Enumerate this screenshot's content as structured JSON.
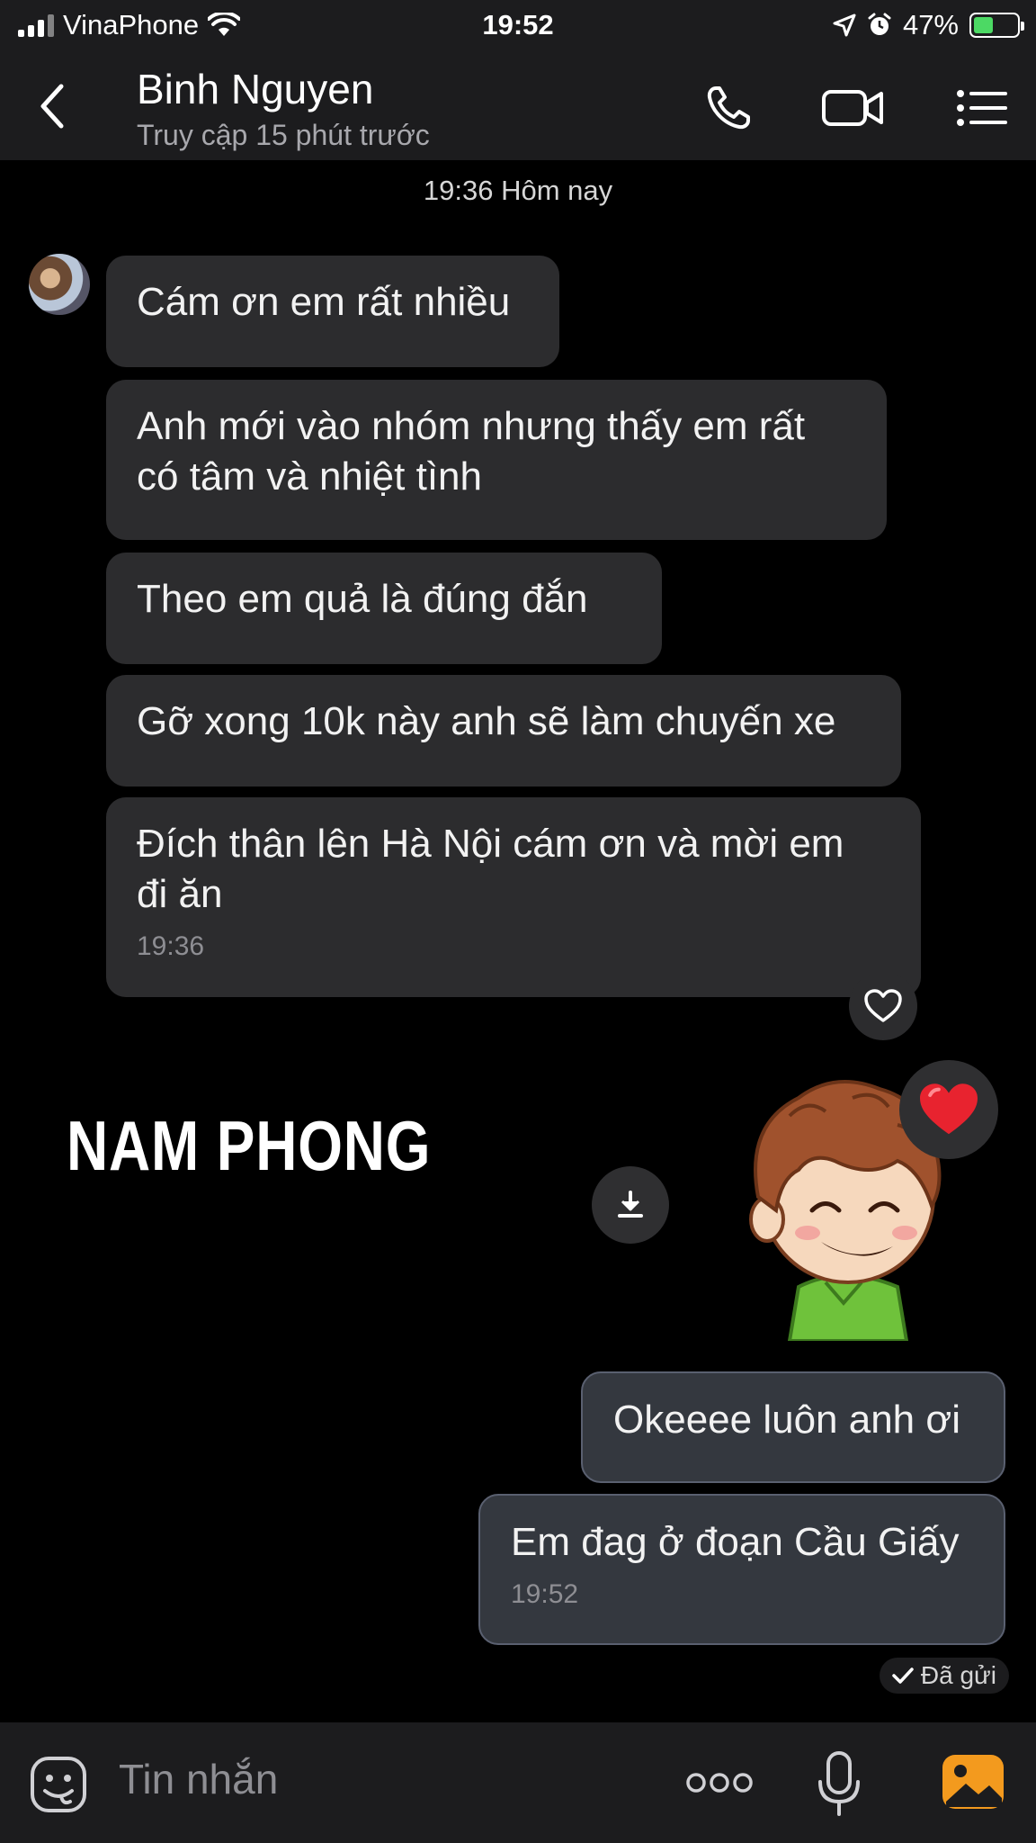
{
  "status_bar": {
    "carrier": "VinaPhone",
    "time": "19:52",
    "battery": "47%",
    "battery_level": 0.47
  },
  "header": {
    "contact_name": "Binh Nguyen",
    "last_seen": "Truy cập 15 phút trước",
    "icons": [
      "back-chevron-icon",
      "phone-icon",
      "video-call-icon",
      "menu-list-icon"
    ]
  },
  "chat": {
    "date_separator": "19:36 Hôm nay",
    "incoming": [
      {
        "text": "Cám ơn em rất nhiều"
      },
      {
        "text_line1": "Anh mới vào nhóm nhưng thấy em rất",
        "text_line2": "có tâm và nhiệt tình"
      },
      {
        "text": "Theo em quả là đúng đắn"
      },
      {
        "text": "Gỡ xong 10k này anh sẽ làm chuyến xe"
      },
      {
        "text_line1": "Đích thân lên Hà Nội cám ơn và mời em",
        "text_line2": "đi ăn",
        "time": "19:36"
      }
    ],
    "watermark": "NAM PHONG",
    "outgoing": [
      {
        "text": "Okeeee luôn anh ơi"
      },
      {
        "text": "Em đag ở đoạn Cầu Giấy",
        "time": "19:52"
      }
    ],
    "sent_status": "Đã gửi"
  },
  "input_bar": {
    "placeholder": "Tin nhắn",
    "icons": [
      "sticker-smile-icon",
      "more-dots-icon",
      "microphone-icon",
      "photo-gallery-icon"
    ]
  },
  "colors": {
    "background": "#000000",
    "bar_background": "#1c1c1e",
    "incoming_bubble": "#2c2c2e",
    "outgoing_bubble": "#34383f",
    "photo_icon_accent": "#f39a1e"
  }
}
